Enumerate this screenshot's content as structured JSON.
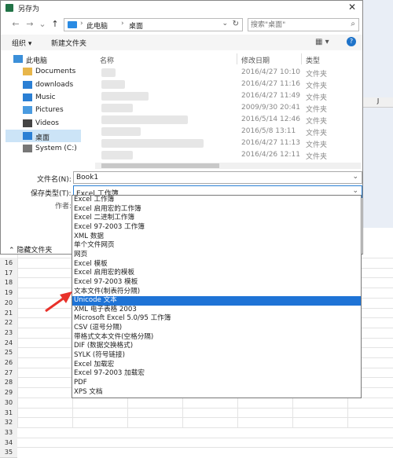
{
  "window": {
    "title": "另存为"
  },
  "address": {
    "crumbs": [
      "此电脑",
      "桌面"
    ]
  },
  "search": {
    "placeholder": "搜索\"桌面\""
  },
  "toolbar": {
    "organize": "组织 ▾",
    "new_folder": "新建文件夹"
  },
  "nav": {
    "items": [
      {
        "label": "此电脑",
        "icon": "computer-icon"
      },
      {
        "label": "Documents",
        "icon": "folder-icon"
      },
      {
        "label": "downloads",
        "icon": "download-icon"
      },
      {
        "label": "Music",
        "icon": "music-icon"
      },
      {
        "label": "Pictures",
        "icon": "pictures-icon"
      },
      {
        "label": "Videos",
        "icon": "video-icon"
      },
      {
        "label": "桌面",
        "icon": "desktop-icon"
      },
      {
        "label": "System (C:)",
        "icon": "drive-icon"
      }
    ]
  },
  "files": {
    "headers": {
      "name": "名称",
      "modified": "修改日期",
      "type": "类型"
    },
    "rows": [
      {
        "date": "2016/4/27 10:10",
        "type": "文件夹"
      },
      {
        "date": "2016/4/27 11:16",
        "type": "文件夹"
      },
      {
        "date": "2016/4/27 11:49",
        "type": "文件夹"
      },
      {
        "date": "2009/9/30 20:41",
        "type": "文件夹"
      },
      {
        "date": "2016/5/14 12:46",
        "type": "文件夹"
      },
      {
        "date": "2016/5/8 13:11",
        "type": "文件夹"
      },
      {
        "date": "2016/4/27 11:13",
        "type": "文件夹"
      },
      {
        "date": "2016/4/26 12:11",
        "type": "文件夹"
      }
    ]
  },
  "form": {
    "filename_label": "文件名(N):",
    "filename_value": "Book1",
    "savetype_label": "保存类型(T):",
    "savetype_value": "Excel 工作簿",
    "authors_label": "作者:",
    "hide_folders": "隐藏文件夹"
  },
  "dropdown": {
    "highlighted_index": 11,
    "options": [
      "Excel 工作簿",
      "Excel 启用宏的工作簿",
      "Excel 二进制工作簿",
      "Excel 97-2003 工作簿",
      "XML 数据",
      "单个文件网页",
      "网页",
      "Excel 模板",
      "Excel 启用宏的模板",
      "Excel 97-2003 模板",
      "文本文件(制表符分隔)",
      "Unicode 文本",
      "XML 电子表格 2003",
      "Microsoft Excel 5.0/95 工作簿",
      "CSV (逗号分隔)",
      "带格式文本文件(空格分隔)",
      "DIF (数据交换格式)",
      "SYLK (符号链接)",
      "Excel 加载宏",
      "Excel 97-2003 加载宏",
      "PDF",
      "XPS 文档"
    ]
  },
  "excel": {
    "row_numbers": [
      "16",
      "17",
      "18",
      "19",
      "20",
      "21",
      "22",
      "23",
      "24",
      "25",
      "26",
      "27",
      "28",
      "29",
      "30",
      "31",
      "32",
      "33",
      "34",
      "35"
    ],
    "column_letter": "J"
  },
  "colors": {
    "highlight": "#1e73d6",
    "selection": "#cce4f7",
    "annotation_arrow": "#e8312a"
  }
}
